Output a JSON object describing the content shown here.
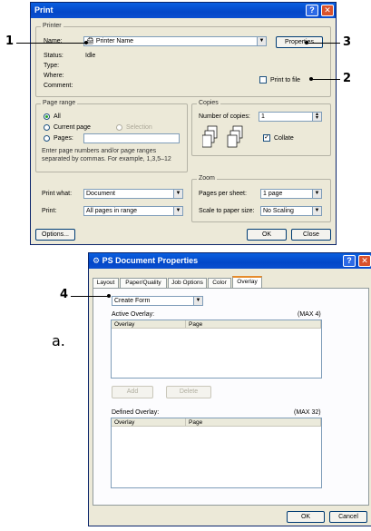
{
  "print_dialog": {
    "title": "Print",
    "printer_group": "Printer",
    "name_label": "Name:",
    "printer_name": "Printer Name",
    "properties_button": "Properties",
    "status_label": "Status:",
    "status_value": "Idle",
    "type_label": "Type:",
    "where_label": "Where:",
    "comment_label": "Comment:",
    "print_to_file": "Print to file",
    "page_range_group": "Page range",
    "range_all": "All",
    "range_current": "Current page",
    "range_selection": "Selection",
    "range_pages": "Pages:",
    "range_hint_1": "Enter page numbers and/or page ranges",
    "range_hint_2": "separated by commas.  For example, 1,3,5–12",
    "copies_group": "Copies",
    "copies_label": "Number of copies:",
    "copies_value": "1",
    "collate_label": "Collate",
    "zoom_group": "Zoom",
    "pages_per_sheet_label": "Pages per sheet:",
    "pages_per_sheet_value": "1 page",
    "scale_label": "Scale to paper size:",
    "scale_value": "No Scaling",
    "print_what_label": "Print what:",
    "print_what_value": "Document",
    "print_label": "Print:",
    "print_value": "All pages in range",
    "options_button": "Options...",
    "ok_button": "OK",
    "close_button": "Close"
  },
  "props_dialog": {
    "title": "PS  Document Properties",
    "tabs": [
      "Layout",
      "Paper/Quality",
      "Job Options",
      "Color",
      "Overlay"
    ],
    "overlay_select": "Create Form",
    "active_overlay_label": "Active Overlay:",
    "active_max": "(MAX 4)",
    "col_overlay": "Overlay",
    "col_page": "Page",
    "add_button": "Add",
    "delete_button": "Delete",
    "defined_overlay_label": "Defined Overlay:",
    "defined_max": "(MAX 32)",
    "ok_button": "OK",
    "cancel_button": "Cancel"
  },
  "callouts": {
    "c1": "1",
    "c2": "2",
    "c3": "3",
    "c4": "4",
    "side_label": "a."
  },
  "colors": {
    "titlebar": "#0347c8",
    "dialog_bg": "#ece9d8",
    "active_tab_accent": "#e68b2c"
  }
}
